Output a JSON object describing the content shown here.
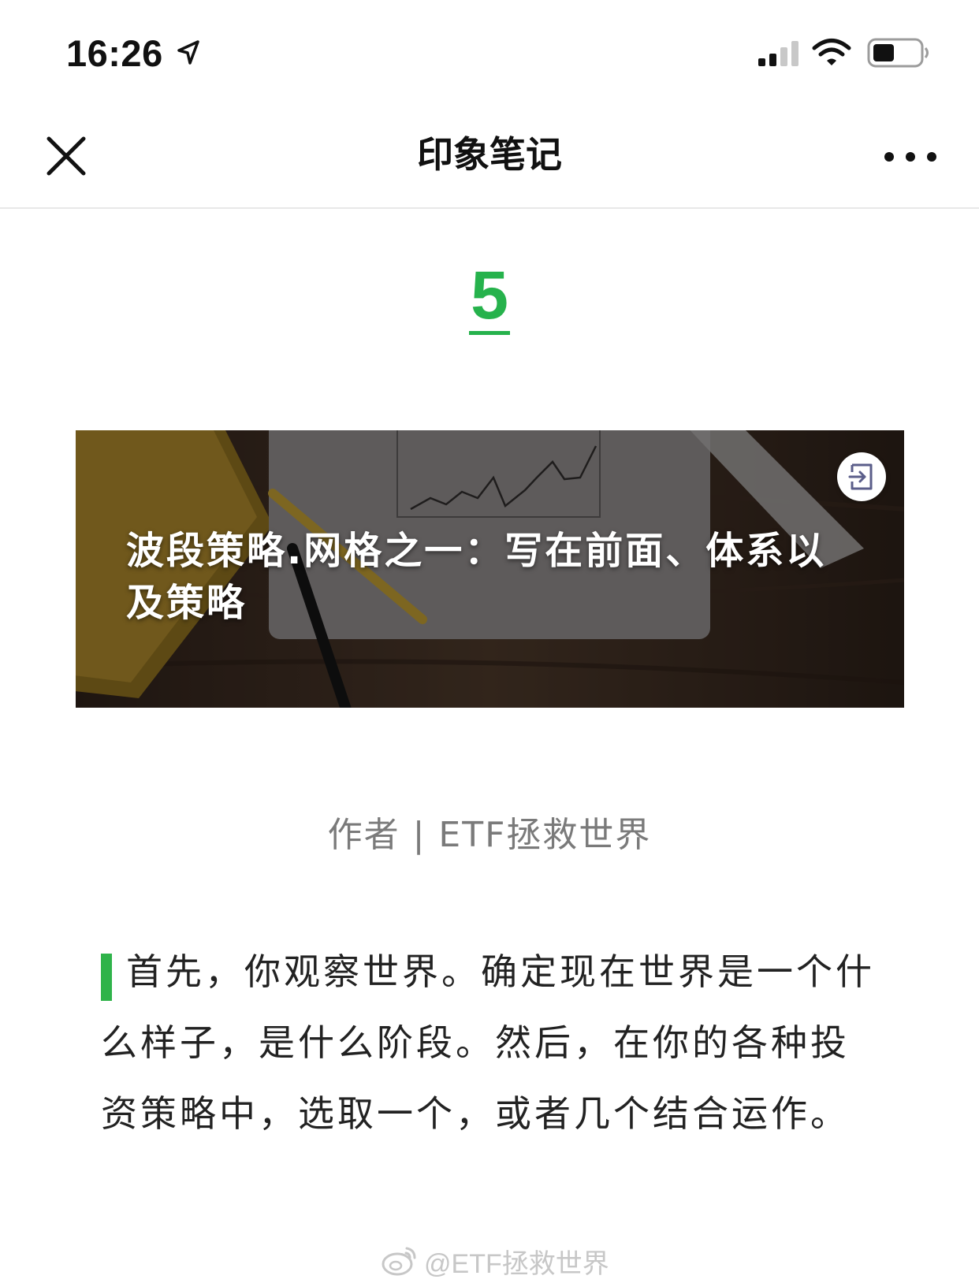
{
  "status_bar": {
    "time": "16:26",
    "icons": [
      "location-arrow-icon",
      "cellular-signal-icon",
      "wifi-icon",
      "battery-icon"
    ]
  },
  "nav": {
    "title": "印象笔记",
    "close_icon": "close-icon",
    "more_icon": "more-dots-icon"
  },
  "article": {
    "section_number": "5",
    "banner_title": "波段策略.网格之一：写在前面、体系以及策略",
    "banner_share_icon": "share-exit-icon",
    "author_line": "作者 | ETF拯救世界",
    "paragraph": "首先，你观察世界。确定现在世界是一个什么样子，是什么阶段。然后，在你的各种投资策略中，选取一个，或者几个结合运作。"
  },
  "watermark": {
    "text": "@ETF拯救世界",
    "icon": "weibo-icon"
  },
  "colors": {
    "accent_green": "#26b24c",
    "author_gray": "#7a7a7a",
    "text": "#222222"
  }
}
